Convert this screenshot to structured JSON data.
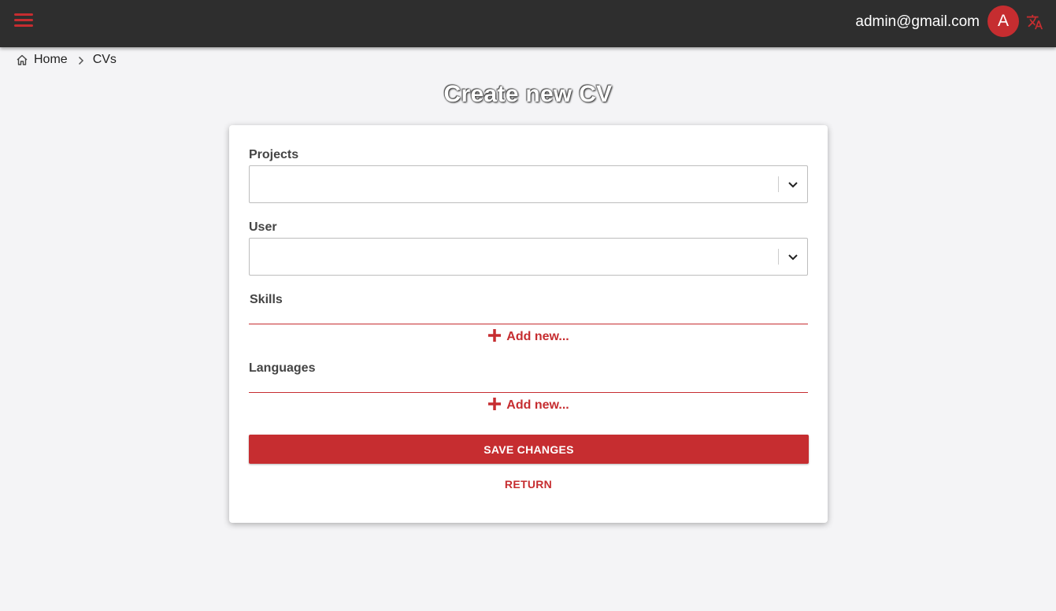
{
  "header": {
    "menu_icon": "hamburger-menu-icon",
    "user_email": "admin@gmail.com",
    "avatar_initial": "A",
    "language_icon": "translate-icon"
  },
  "breadcrumb": {
    "home_icon": "home-icon",
    "home_label": "Home",
    "separator_icon": "chevron-right-icon",
    "current_label": "CVs"
  },
  "page": {
    "title": "Create new CV"
  },
  "form": {
    "projects": {
      "label": "Projects",
      "value": ""
    },
    "user": {
      "label": "User",
      "value": ""
    },
    "skills": {
      "label": "Skills",
      "add_label": "Add new..."
    },
    "languages": {
      "label": "Languages",
      "add_label": "Add new..."
    },
    "save_label": "SAVE CHANGES",
    "return_label": "RETURN"
  },
  "colors": {
    "accent": "#c62d30",
    "topbar": "#2e2e2e",
    "background": "#f4f4f6"
  }
}
